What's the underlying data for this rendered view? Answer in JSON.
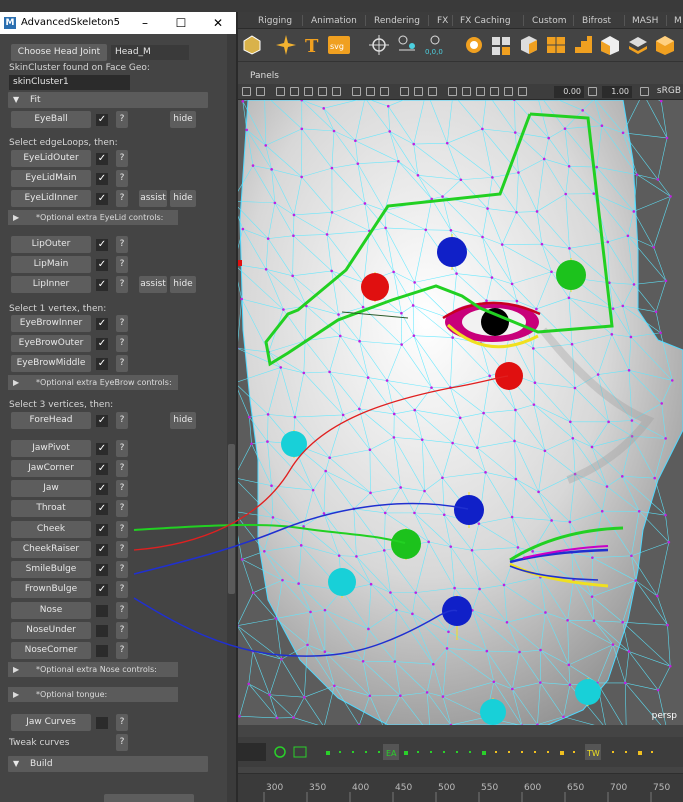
{
  "title_bar": {
    "title": "AdvancedSkeleton5"
  },
  "shelf_tabs": [
    "Rigging",
    "Animation",
    "Rendering",
    "FX",
    "FX Caching",
    "Custom",
    "Bifrost",
    "MASH",
    "M"
  ],
  "panels_menu": "Panels",
  "viewport_toolbar": {
    "value1": "0.00",
    "value2": "1.00",
    "colorspace": "sRGB"
  },
  "viewport": {
    "camera_label": "persp"
  },
  "time_ruler": {
    "ticks": [
      "300",
      "350",
      "400",
      "450",
      "500",
      "550",
      "600",
      "650",
      "700",
      "750"
    ]
  },
  "timeline_markers": {
    "ea": "EA",
    "tw": "TW"
  },
  "face_setup": {
    "head_joint_button": "Choose Head Joint",
    "head_joint_value": "Head_M",
    "skincluster_note": "SkinCluster found on Face Geo:",
    "skincluster_value": "skinCluster1",
    "fit_frame": "Fit",
    "eyeball": {
      "label": "EyeBall",
      "hide": "hide"
    },
    "edgeloops_note": "Select edgeLoops, then:",
    "eyelid_outer": "EyeLidOuter",
    "eyelid_main": "EyeLidMain",
    "eyelid_inner": "EyeLidInner",
    "assist": "assist",
    "hide": "hide",
    "opt_eyelid": "*Optional extra EyeLid controls:",
    "lip_outer": "LipOuter",
    "lip_main": "LipMain",
    "lip_inner": "LipInner",
    "vertex_note": "Select 1 vertex, then:",
    "eyebrow_inner": "EyeBrowInner",
    "eyebrow_outer": "EyeBrowOuter",
    "eyebrow_middle": "EyeBrowMiddle",
    "opt_eyebrow": "*Optional extra EyeBrow controls:",
    "vertices_note": "Select 3 vertices, then:",
    "forehead": "ForeHead",
    "jaw_pivot": "JawPivot",
    "jaw_corner": "JawCorner",
    "jaw": "Jaw",
    "throat": "Throat",
    "cheek": "Cheek",
    "cheek_raiser": "CheekRaiser",
    "smile_bulge": "SmileBulge",
    "frown_bulge": "FrownBulge",
    "nose": "Nose",
    "nose_under": "NoseUnder",
    "nose_corner": "NoseCorner",
    "opt_nose": "*Optional extra Nose controls:",
    "opt_tongue": "*Optional tongue:",
    "jaw_curves": "Jaw Curves",
    "tweak_curves": "Tweak curves",
    "build_frame": "Build",
    "question": "?",
    "check": "✓"
  },
  "colors": {
    "marker_red": "#e01010",
    "marker_blue": "#1020c8",
    "marker_green": "#1cc21c",
    "marker_cyan": "#18d0d8",
    "curve_green": "#22d022",
    "curve_red": "#e02020",
    "curve_blue": "#2030d0",
    "wire": "#5ee8ff",
    "vertex": "#c020e0"
  }
}
